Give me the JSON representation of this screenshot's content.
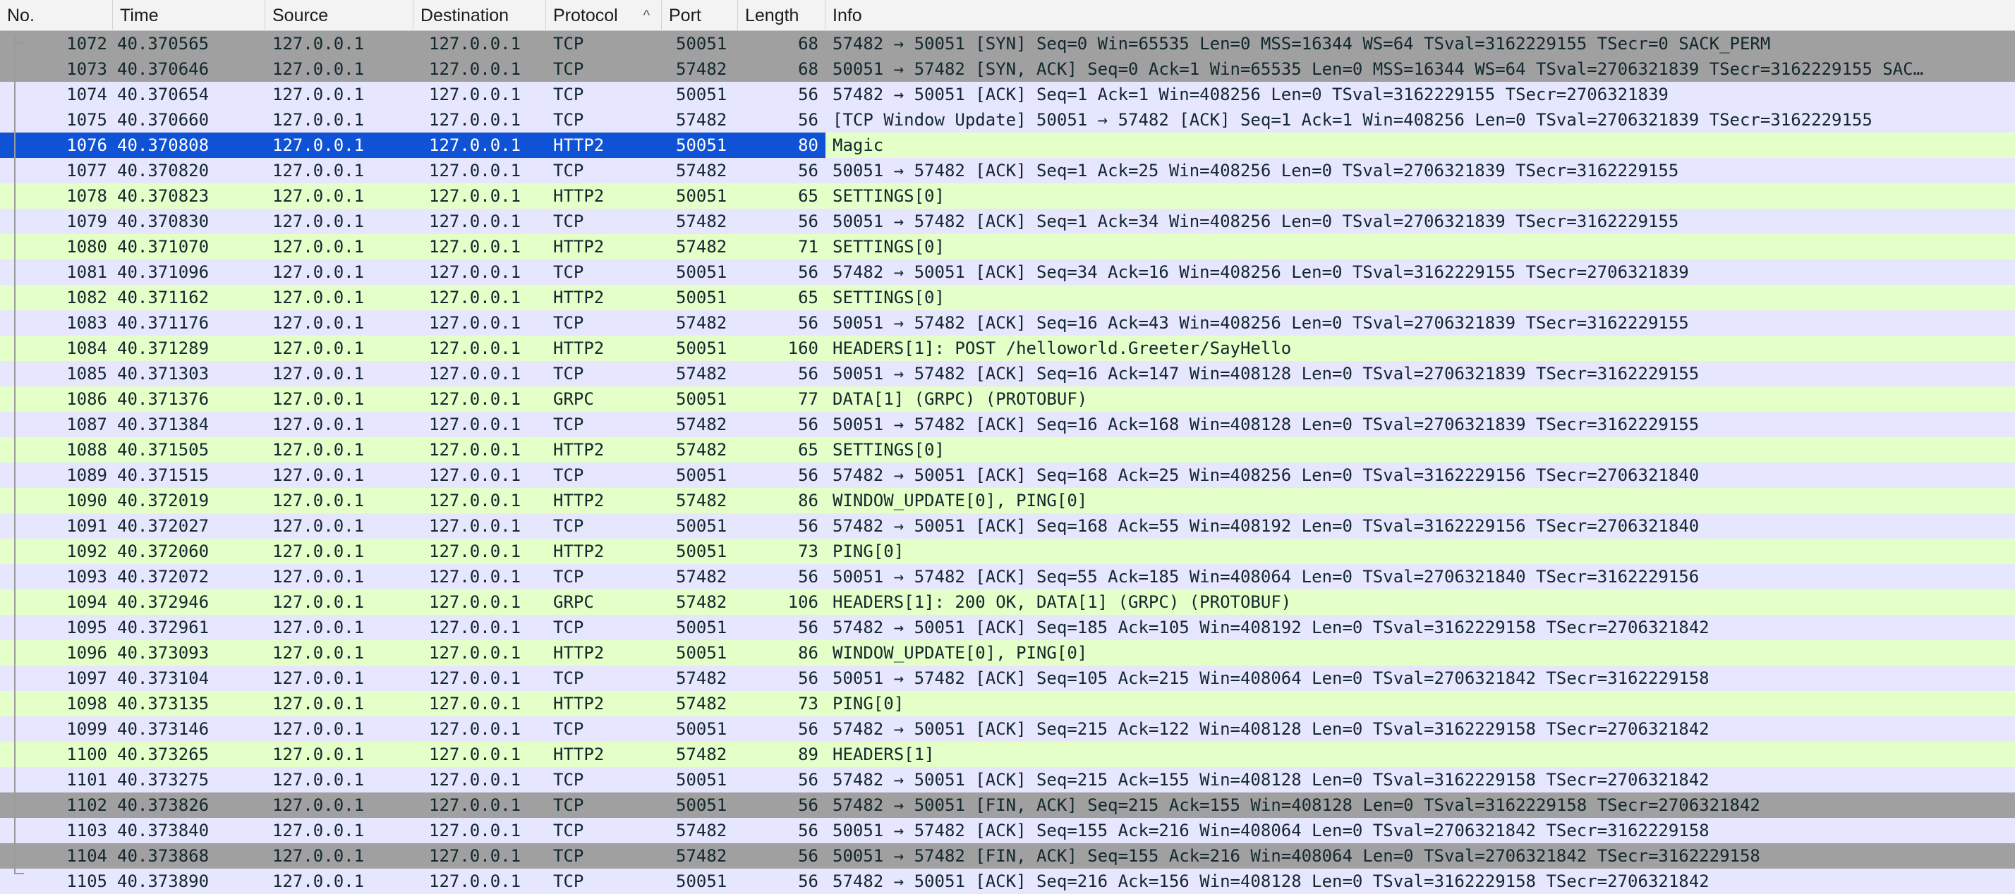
{
  "columns": {
    "no": "No.",
    "time": "Time",
    "source": "Source",
    "destination": "Destination",
    "protocol": "Protocol",
    "port": "Port",
    "length": "Length",
    "info": "Info"
  },
  "sort_icon": "^",
  "colors": {
    "tcp_row": "#e7e6ff",
    "http2_row": "#e4ffc7",
    "flag_row": "#a0a0a0",
    "selected_row": "#0f52d6"
  },
  "selected_packet": "1076",
  "packets": [
    {
      "no": "1072",
      "time": "40.370565",
      "src": "127.0.0.1",
      "dst": "127.0.0.1",
      "proto": "TCP",
      "port": "50051",
      "len": "68",
      "info": "57482 → 50051 [SYN] Seq=0 Win=65535 Len=0 MSS=16344 WS=64 TSval=3162229155 TSecr=0 SACK_PERM",
      "style": "grey"
    },
    {
      "no": "1073",
      "time": "40.370646",
      "src": "127.0.0.1",
      "dst": "127.0.0.1",
      "proto": "TCP",
      "port": "57482",
      "len": "68",
      "info": "50051 → 57482 [SYN, ACK] Seq=0 Ack=1 Win=65535 Len=0 MSS=16344 WS=64 TSval=2706321839 TSecr=3162229155 SAC…",
      "style": "grey"
    },
    {
      "no": "1074",
      "time": "40.370654",
      "src": "127.0.0.1",
      "dst": "127.0.0.1",
      "proto": "TCP",
      "port": "50051",
      "len": "56",
      "info": "57482 → 50051 [ACK] Seq=1 Ack=1 Win=408256 Len=0 TSval=3162229155 TSecr=2706321839",
      "style": "tcp"
    },
    {
      "no": "1075",
      "time": "40.370660",
      "src": "127.0.0.1",
      "dst": "127.0.0.1",
      "proto": "TCP",
      "port": "57482",
      "len": "56",
      "info": "[TCP Window Update] 50051 → 57482 [ACK] Seq=1 Ack=1 Win=408256 Len=0 TSval=2706321839 TSecr=3162229155",
      "style": "tcp"
    },
    {
      "no": "1076",
      "time": "40.370808",
      "src": "127.0.0.1",
      "dst": "127.0.0.1",
      "proto": "HTTP2",
      "port": "50051",
      "len": "80",
      "info": "Magic",
      "style": "sel"
    },
    {
      "no": "1077",
      "time": "40.370820",
      "src": "127.0.0.1",
      "dst": "127.0.0.1",
      "proto": "TCP",
      "port": "57482",
      "len": "56",
      "info": "50051 → 57482 [ACK] Seq=1 Ack=25 Win=408256 Len=0 TSval=2706321839 TSecr=3162229155",
      "style": "tcp"
    },
    {
      "no": "1078",
      "time": "40.370823",
      "src": "127.0.0.1",
      "dst": "127.0.0.1",
      "proto": "HTTP2",
      "port": "50051",
      "len": "65",
      "info": "SETTINGS[0]",
      "style": "http"
    },
    {
      "no": "1079",
      "time": "40.370830",
      "src": "127.0.0.1",
      "dst": "127.0.0.1",
      "proto": "TCP",
      "port": "57482",
      "len": "56",
      "info": "50051 → 57482 [ACK] Seq=1 Ack=34 Win=408256 Len=0 TSval=2706321839 TSecr=3162229155",
      "style": "tcp"
    },
    {
      "no": "1080",
      "time": "40.371070",
      "src": "127.0.0.1",
      "dst": "127.0.0.1",
      "proto": "HTTP2",
      "port": "57482",
      "len": "71",
      "info": "SETTINGS[0]",
      "style": "http"
    },
    {
      "no": "1081",
      "time": "40.371096",
      "src": "127.0.0.1",
      "dst": "127.0.0.1",
      "proto": "TCP",
      "port": "50051",
      "len": "56",
      "info": "57482 → 50051 [ACK] Seq=34 Ack=16 Win=408256 Len=0 TSval=3162229155 TSecr=2706321839",
      "style": "tcp"
    },
    {
      "no": "1082",
      "time": "40.371162",
      "src": "127.0.0.1",
      "dst": "127.0.0.1",
      "proto": "HTTP2",
      "port": "50051",
      "len": "65",
      "info": "SETTINGS[0]",
      "style": "http"
    },
    {
      "no": "1083",
      "time": "40.371176",
      "src": "127.0.0.1",
      "dst": "127.0.0.1",
      "proto": "TCP",
      "port": "57482",
      "len": "56",
      "info": "50051 → 57482 [ACK] Seq=16 Ack=43 Win=408256 Len=0 TSval=2706321839 TSecr=3162229155",
      "style": "tcp"
    },
    {
      "no": "1084",
      "time": "40.371289",
      "src": "127.0.0.1",
      "dst": "127.0.0.1",
      "proto": "HTTP2",
      "port": "50051",
      "len": "160",
      "info": "HEADERS[1]: POST /helloworld.Greeter/SayHello",
      "style": "http"
    },
    {
      "no": "1085",
      "time": "40.371303",
      "src": "127.0.0.1",
      "dst": "127.0.0.1",
      "proto": "TCP",
      "port": "57482",
      "len": "56",
      "info": "50051 → 57482 [ACK] Seq=16 Ack=147 Win=408128 Len=0 TSval=2706321839 TSecr=3162229155",
      "style": "tcp"
    },
    {
      "no": "1086",
      "time": "40.371376",
      "src": "127.0.0.1",
      "dst": "127.0.0.1",
      "proto": "GRPC",
      "port": "50051",
      "len": "77",
      "info": "DATA[1] (GRPC) (PROTOBUF)",
      "style": "http"
    },
    {
      "no": "1087",
      "time": "40.371384",
      "src": "127.0.0.1",
      "dst": "127.0.0.1",
      "proto": "TCP",
      "port": "57482",
      "len": "56",
      "info": "50051 → 57482 [ACK] Seq=16 Ack=168 Win=408128 Len=0 TSval=2706321839 TSecr=3162229155",
      "style": "tcp"
    },
    {
      "no": "1088",
      "time": "40.371505",
      "src": "127.0.0.1",
      "dst": "127.0.0.1",
      "proto": "HTTP2",
      "port": "57482",
      "len": "65",
      "info": "SETTINGS[0]",
      "style": "http"
    },
    {
      "no": "1089",
      "time": "40.371515",
      "src": "127.0.0.1",
      "dst": "127.0.0.1",
      "proto": "TCP",
      "port": "50051",
      "len": "56",
      "info": "57482 → 50051 [ACK] Seq=168 Ack=25 Win=408256 Len=0 TSval=3162229156 TSecr=2706321840",
      "style": "tcp"
    },
    {
      "no": "1090",
      "time": "40.372019",
      "src": "127.0.0.1",
      "dst": "127.0.0.1",
      "proto": "HTTP2",
      "port": "57482",
      "len": "86",
      "info": "WINDOW_UPDATE[0], PING[0]",
      "style": "http"
    },
    {
      "no": "1091",
      "time": "40.372027",
      "src": "127.0.0.1",
      "dst": "127.0.0.1",
      "proto": "TCP",
      "port": "50051",
      "len": "56",
      "info": "57482 → 50051 [ACK] Seq=168 Ack=55 Win=408192 Len=0 TSval=3162229156 TSecr=2706321840",
      "style": "tcp"
    },
    {
      "no": "1092",
      "time": "40.372060",
      "src": "127.0.0.1",
      "dst": "127.0.0.1",
      "proto": "HTTP2",
      "port": "50051",
      "len": "73",
      "info": "PING[0]",
      "style": "http"
    },
    {
      "no": "1093",
      "time": "40.372072",
      "src": "127.0.0.1",
      "dst": "127.0.0.1",
      "proto": "TCP",
      "port": "57482",
      "len": "56",
      "info": "50051 → 57482 [ACK] Seq=55 Ack=185 Win=408064 Len=0 TSval=2706321840 TSecr=3162229156",
      "style": "tcp"
    },
    {
      "no": "1094",
      "time": "40.372946",
      "src": "127.0.0.1",
      "dst": "127.0.0.1",
      "proto": "GRPC",
      "port": "57482",
      "len": "106",
      "info": "HEADERS[1]: 200 OK, DATA[1] (GRPC) (PROTOBUF)",
      "style": "http"
    },
    {
      "no": "1095",
      "time": "40.372961",
      "src": "127.0.0.1",
      "dst": "127.0.0.1",
      "proto": "TCP",
      "port": "50051",
      "len": "56",
      "info": "57482 → 50051 [ACK] Seq=185 Ack=105 Win=408192 Len=0 TSval=3162229158 TSecr=2706321842",
      "style": "tcp"
    },
    {
      "no": "1096",
      "time": "40.373093",
      "src": "127.0.0.1",
      "dst": "127.0.0.1",
      "proto": "HTTP2",
      "port": "50051",
      "len": "86",
      "info": "WINDOW_UPDATE[0], PING[0]",
      "style": "http"
    },
    {
      "no": "1097",
      "time": "40.373104",
      "src": "127.0.0.1",
      "dst": "127.0.0.1",
      "proto": "TCP",
      "port": "57482",
      "len": "56",
      "info": "50051 → 57482 [ACK] Seq=105 Ack=215 Win=408064 Len=0 TSval=2706321842 TSecr=3162229158",
      "style": "tcp"
    },
    {
      "no": "1098",
      "time": "40.373135",
      "src": "127.0.0.1",
      "dst": "127.0.0.1",
      "proto": "HTTP2",
      "port": "57482",
      "len": "73",
      "info": "PING[0]",
      "style": "http"
    },
    {
      "no": "1099",
      "time": "40.373146",
      "src": "127.0.0.1",
      "dst": "127.0.0.1",
      "proto": "TCP",
      "port": "50051",
      "len": "56",
      "info": "57482 → 50051 [ACK] Seq=215 Ack=122 Win=408128 Len=0 TSval=3162229158 TSecr=2706321842",
      "style": "tcp"
    },
    {
      "no": "1100",
      "time": "40.373265",
      "src": "127.0.0.1",
      "dst": "127.0.0.1",
      "proto": "HTTP2",
      "port": "57482",
      "len": "89",
      "info": "HEADERS[1]",
      "style": "http"
    },
    {
      "no": "1101",
      "time": "40.373275",
      "src": "127.0.0.1",
      "dst": "127.0.0.1",
      "proto": "TCP",
      "port": "50051",
      "len": "56",
      "info": "57482 → 50051 [ACK] Seq=215 Ack=155 Win=408128 Len=0 TSval=3162229158 TSecr=2706321842",
      "style": "tcp"
    },
    {
      "no": "1102",
      "time": "40.373826",
      "src": "127.0.0.1",
      "dst": "127.0.0.1",
      "proto": "TCP",
      "port": "50051",
      "len": "56",
      "info": "57482 → 50051 [FIN, ACK] Seq=215 Ack=155 Win=408128 Len=0 TSval=3162229158 TSecr=2706321842",
      "style": "grey"
    },
    {
      "no": "1103",
      "time": "40.373840",
      "src": "127.0.0.1",
      "dst": "127.0.0.1",
      "proto": "TCP",
      "port": "57482",
      "len": "56",
      "info": "50051 → 57482 [ACK] Seq=155 Ack=216 Win=408064 Len=0 TSval=2706321842 TSecr=3162229158",
      "style": "tcp"
    },
    {
      "no": "1104",
      "time": "40.373868",
      "src": "127.0.0.1",
      "dst": "127.0.0.1",
      "proto": "TCP",
      "port": "57482",
      "len": "56",
      "info": "50051 → 57482 [FIN, ACK] Seq=155 Ack=216 Win=408064 Len=0 TSval=2706321842 TSecr=3162229158",
      "style": "grey"
    },
    {
      "no": "1105",
      "time": "40.373890",
      "src": "127.0.0.1",
      "dst": "127.0.0.1",
      "proto": "TCP",
      "port": "50051",
      "len": "56",
      "info": "57482 → 50051 [ACK] Seq=216 Ack=156 Win=408128 Len=0 TSval=3162229158 TSecr=2706321842",
      "style": "tcp"
    }
  ]
}
